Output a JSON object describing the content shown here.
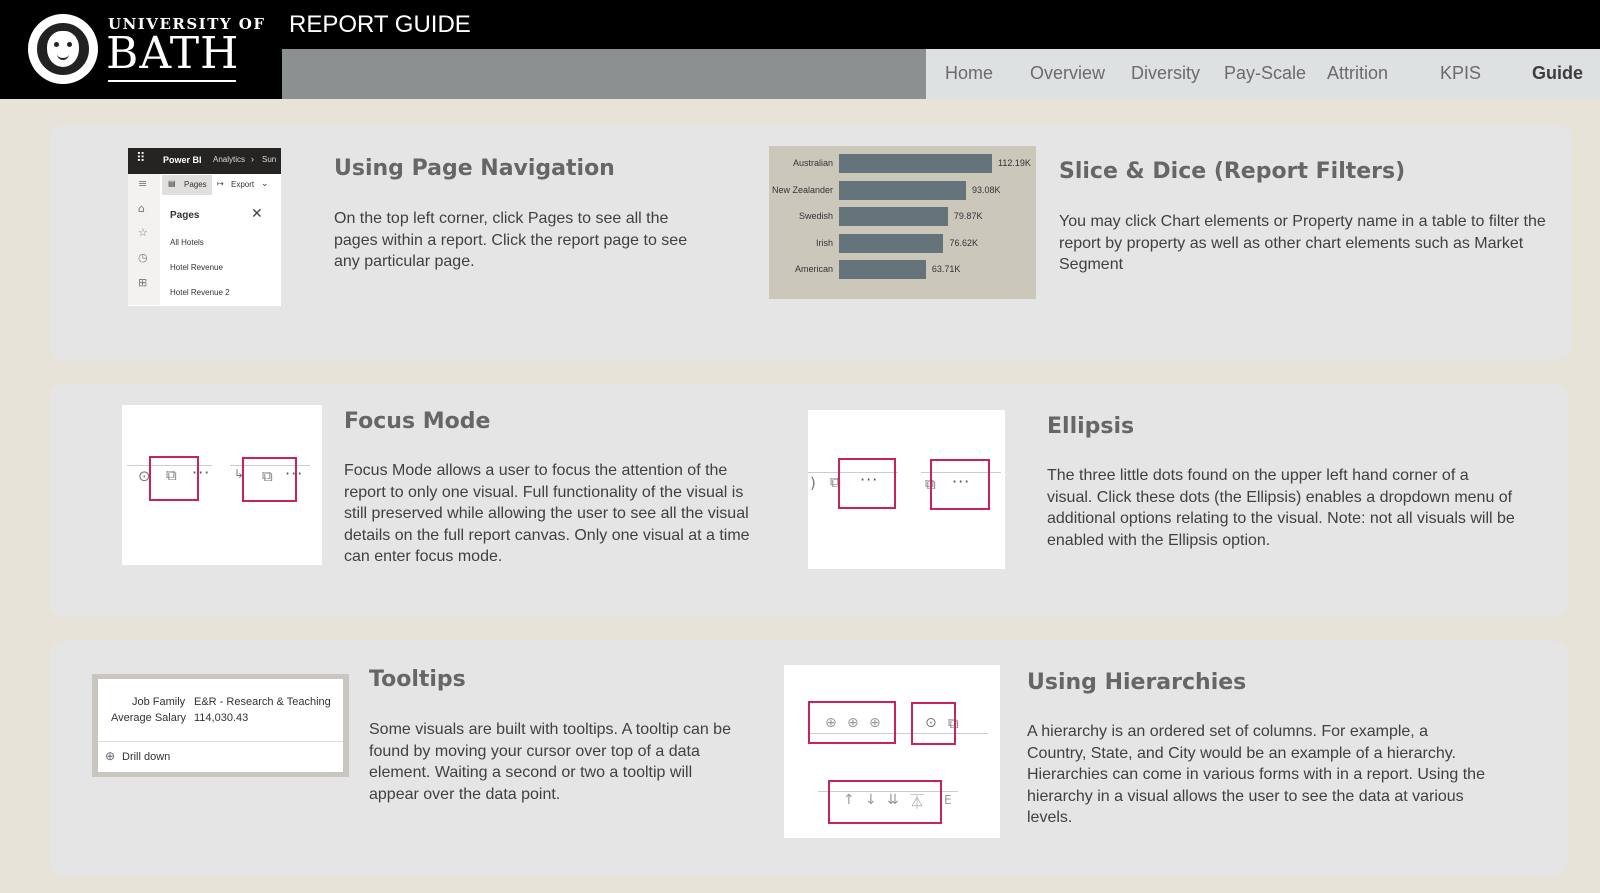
{
  "header": {
    "university_of": "UNIVERSITY OF",
    "university_name": "BATH",
    "report_title": "REPORT GUIDE"
  },
  "nav": {
    "items": [
      {
        "label": "Home"
      },
      {
        "label": "Overview"
      },
      {
        "label": "Diversity"
      },
      {
        "label": "Pay-Scale"
      },
      {
        "label": "Attrition"
      },
      {
        "label": "KPIS"
      },
      {
        "label": "Guide"
      }
    ],
    "active": "Guide"
  },
  "sections": {
    "page_nav": {
      "title": "Using Page Navigation",
      "body": "On the top left corner, click Pages to see all the pages within a report. Click the report page to see any particular page.",
      "thumb": {
        "app": "Power BI",
        "crumb": "Analytics",
        "crumb_next": "Sun",
        "pages_btn": "Pages",
        "export_btn": "Export",
        "pages_header": "Pages",
        "pages": [
          "All Hotels",
          "Hotel Revenue",
          "Hotel Revenue 2"
        ]
      }
    },
    "slice_dice": {
      "title": "Slice & Dice (Report Filters)",
      "body": "You may click Chart elements or Property name in a table to filter the report by property as well as other chart elements such as Market Segment"
    },
    "focus_mode": {
      "title": "Focus Mode",
      "body": "Focus Mode allows a user to focus the attention of the report to only one visual.  Full functionality of the visual is still preserved while allowing the user to see all the visual details on the full report canvas.  Only one visual at a time can enter focus mode."
    },
    "ellipsis": {
      "title": "Ellipsis",
      "body": "The three little dots found on the upper left hand corner of a visual.  Click these dots (the Ellipsis) enables a dropdown menu of additional options relating to the visual.  Note: not all visuals will be enabled with the Ellipsis option."
    },
    "tooltips": {
      "title": "Tooltips",
      "body": "Some visuals are built with tooltips.  A tooltip can be found by moving your cursor over top of a data element.  Waiting a second or two a tooltip will appear over the data point.",
      "thumb": {
        "row1_label": "Job Family",
        "row1_value": "E&R - Research & Teaching",
        "row2_label": "Average Salary",
        "row2_value": "114,030.43",
        "action": "Drill down"
      }
    },
    "hierarchies": {
      "title": "Using Hierarchies",
      "body": "A hierarchy is an ordered set of columns.  For example, a Country, State, and City would be an example of a hierarchy.  Hierarchies can come in various forms with in a report.  Using the hierarchy in a visual allows the user to see the data at various levels."
    }
  },
  "chart_data": {
    "type": "bar",
    "orientation": "horizontal",
    "categories": [
      "Australian",
      "New Zealander",
      "Swedish",
      "Irish",
      "American"
    ],
    "values": [
      112.19,
      93.08,
      79.87,
      76.62,
      63.71
    ],
    "value_labels": [
      "112.19K",
      "93.08K",
      "79.87K",
      "76.62K",
      "63.71K"
    ],
    "xlim": [
      0,
      115
    ],
    "bar_color": "#65737b",
    "background": "#cbc7bb"
  },
  "colors": {
    "accent_pink": "#c8235e",
    "header_black": "#000000",
    "nav_bg": "#dde1e2",
    "panel_bg": "#e5e5e5",
    "page_bg": "#e8e3d8"
  }
}
